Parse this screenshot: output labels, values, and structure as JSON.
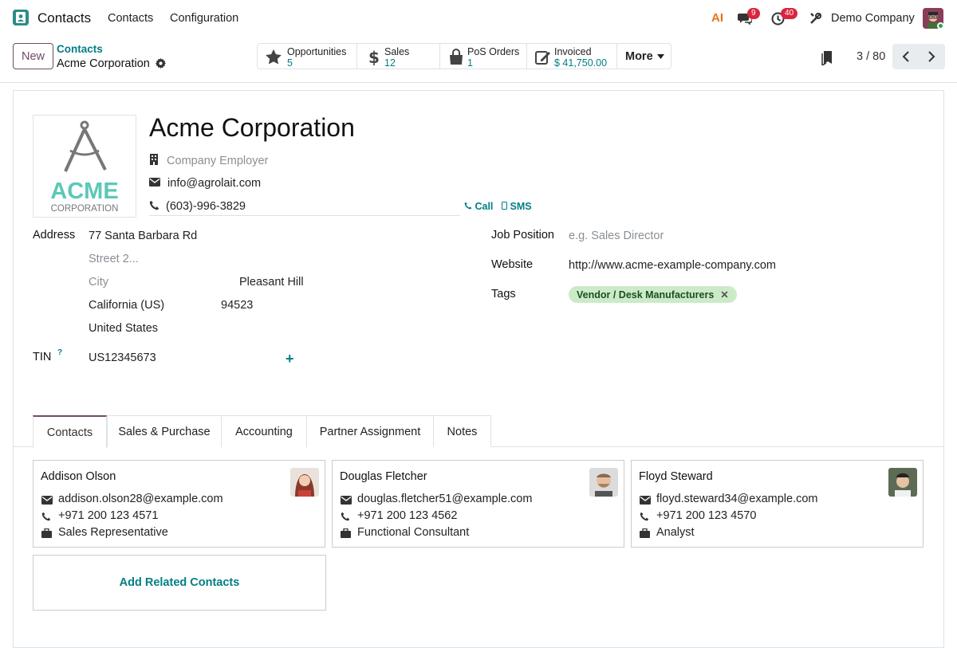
{
  "navbar": {
    "app_name": "Contacts",
    "menu": [
      "Contacts",
      "Configuration"
    ],
    "ai_label": "AI",
    "messages_count": "9",
    "activities_count": "40",
    "company": "Demo Company"
  },
  "control": {
    "new_label": "New",
    "breadcrumb_parent": "Contacts",
    "breadcrumb_current": "Acme Corporation",
    "smart_buttons": [
      {
        "label": "Opportunities",
        "value": "5",
        "icon": "star-icon"
      },
      {
        "label": "Sales",
        "value": "12",
        "icon": "dollar-icon"
      },
      {
        "label": "PoS Orders",
        "value": "1",
        "icon": "shopping-bag-icon"
      },
      {
        "label": "Invoiced",
        "value": "$ 41,750.00",
        "icon": "edit-invoice-icon"
      }
    ],
    "more_label": "More",
    "pager": "3 / 80"
  },
  "partner": {
    "name": "Acme Corporation",
    "logo_line1": "ACME",
    "logo_line2": "CORPORATION",
    "company_placeholder": "Company Employer",
    "email": "info@agrolait.com",
    "phone": "(603)-996-3829",
    "call_label": "Call",
    "sms_label": "SMS",
    "address_label": "Address",
    "street": "77 Santa Barbara Rd",
    "street2_placeholder": "Street 2...",
    "city_placeholder": "City",
    "city": "Pleasant Hill",
    "state": "California (US)",
    "zip": "94523",
    "country": "United States",
    "tin_label": "TIN",
    "tin_help": "?",
    "tin": "US12345673",
    "job_label": "Job Position",
    "job_placeholder": "e.g. Sales Director",
    "website_label": "Website",
    "website": "http://www.acme-example-company.com",
    "tags_label": "Tags",
    "tag": "Vendor / Desk Manufacturers"
  },
  "tabs": [
    "Contacts",
    "Sales & Purchase",
    "Accounting",
    "Partner Assignment",
    "Notes"
  ],
  "contacts": [
    {
      "name": "Addison Olson",
      "email": "addison.olson28@example.com",
      "phone": "+971 200 123 4571",
      "job": "Sales Representative"
    },
    {
      "name": "Douglas Fletcher",
      "email": "douglas.fletcher51@example.com",
      "phone": "+971 200 123 4562",
      "job": "Functional Consultant"
    },
    {
      "name": "Floyd Steward",
      "email": "floyd.steward34@example.com",
      "phone": "+971 200 123 4570",
      "job": "Analyst"
    }
  ],
  "add_contacts_label": "Add Related Contacts",
  "colors": {
    "primary": "#714b67",
    "teal": "#017e84",
    "tag_bg": "#cbebc8",
    "badge": "#d9263d"
  }
}
